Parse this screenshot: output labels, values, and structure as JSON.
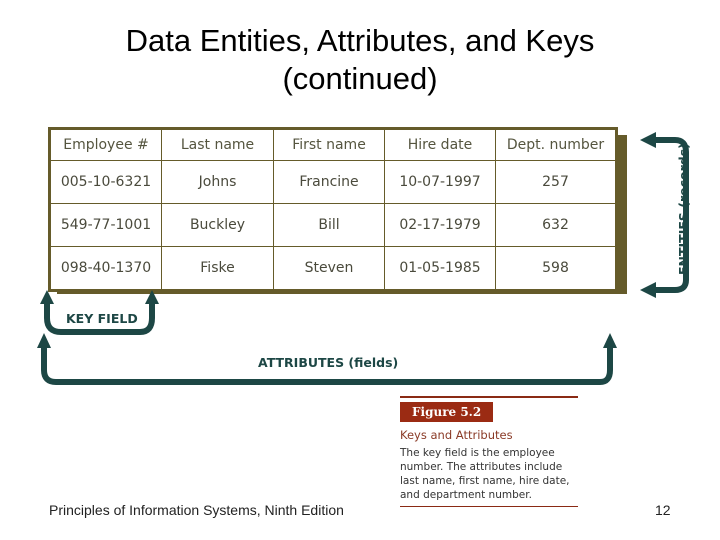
{
  "slide": {
    "title_line1": "Data Entities, Attributes, and Keys",
    "title_line2": "(continued)",
    "footer": "Principles of Information Systems, Ninth Edition",
    "page_number": "12"
  },
  "table": {
    "headers": [
      "Employee #",
      "Last name",
      "First name",
      "Hire date",
      "Dept. number"
    ],
    "rows": [
      [
        "005-10-6321",
        "Johns",
        "Francine",
        "10-07-1997",
        "257"
      ],
      [
        "549-77-1001",
        "Buckley",
        "Bill",
        "02-17-1979",
        "632"
      ],
      [
        "098-40-1370",
        "Fiske",
        "Steven",
        "01-05-1985",
        "598"
      ]
    ]
  },
  "labels": {
    "key_field": "KEY FIELD",
    "attributes": "ATTRIBUTES (fields)",
    "entities": "ENTITIES (records)"
  },
  "figure": {
    "badge": "Figure 5.2",
    "title": "Keys and Attributes",
    "description": "The key field is the employee number. The attributes include last name, first name, hire date, and department number."
  },
  "colors": {
    "table_border": "#655b2a",
    "arrow": "#1d4745",
    "figure_accent": "#9b2b13"
  }
}
